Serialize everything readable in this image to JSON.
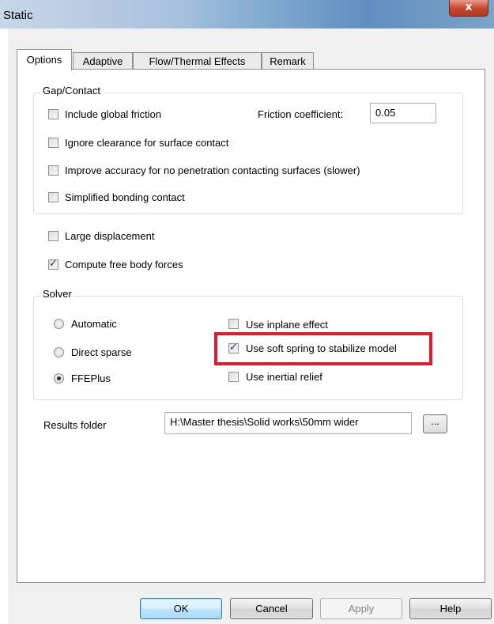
{
  "window": {
    "title": "Static",
    "close_glyph": "x"
  },
  "tabs": [
    "Options",
    "Adaptive",
    "Flow/Thermal Effects",
    "Remark"
  ],
  "gap_contact": {
    "title": "Gap/Contact",
    "include_friction": {
      "label": "Include global friction",
      "checked": false
    },
    "friction_label": "Friction coefficient:",
    "friction_value": "0.05",
    "ignore_clearance": {
      "label": "Ignore clearance for surface contact",
      "checked": false
    },
    "improve_accuracy": {
      "label": "Improve accuracy for no penetration contacting surfaces (slower)",
      "checked": false
    },
    "simplified_bonding": {
      "label": "Simplified bonding contact",
      "checked": false
    }
  },
  "large_displacement": {
    "label": "Large displacement",
    "checked": false
  },
  "free_body_forces": {
    "label": "Compute free body forces",
    "checked": true
  },
  "solver": {
    "title": "Solver",
    "options": [
      {
        "label": "Automatic",
        "selected": false
      },
      {
        "label": "Direct sparse",
        "selected": false
      },
      {
        "label": "FFEPlus",
        "selected": true
      }
    ],
    "inplane": {
      "label": "Use inplane effect",
      "checked": false
    },
    "soft_spring": {
      "label": "Use soft spring to stabilize model",
      "checked": true
    },
    "inertial_relief": {
      "label": "Use inertial relief",
      "checked": false
    }
  },
  "results": {
    "label": "Results folder",
    "path": "H:\\Master thesis\\Solid works\\50mm wider",
    "browse": "..."
  },
  "buttons": {
    "ok": "OK",
    "cancel": "Cancel",
    "apply": "Apply",
    "help": "Help"
  },
  "colors": {
    "highlight": "#e5192d",
    "title_bar": "#7ea8cf",
    "close": "#c7442c"
  }
}
